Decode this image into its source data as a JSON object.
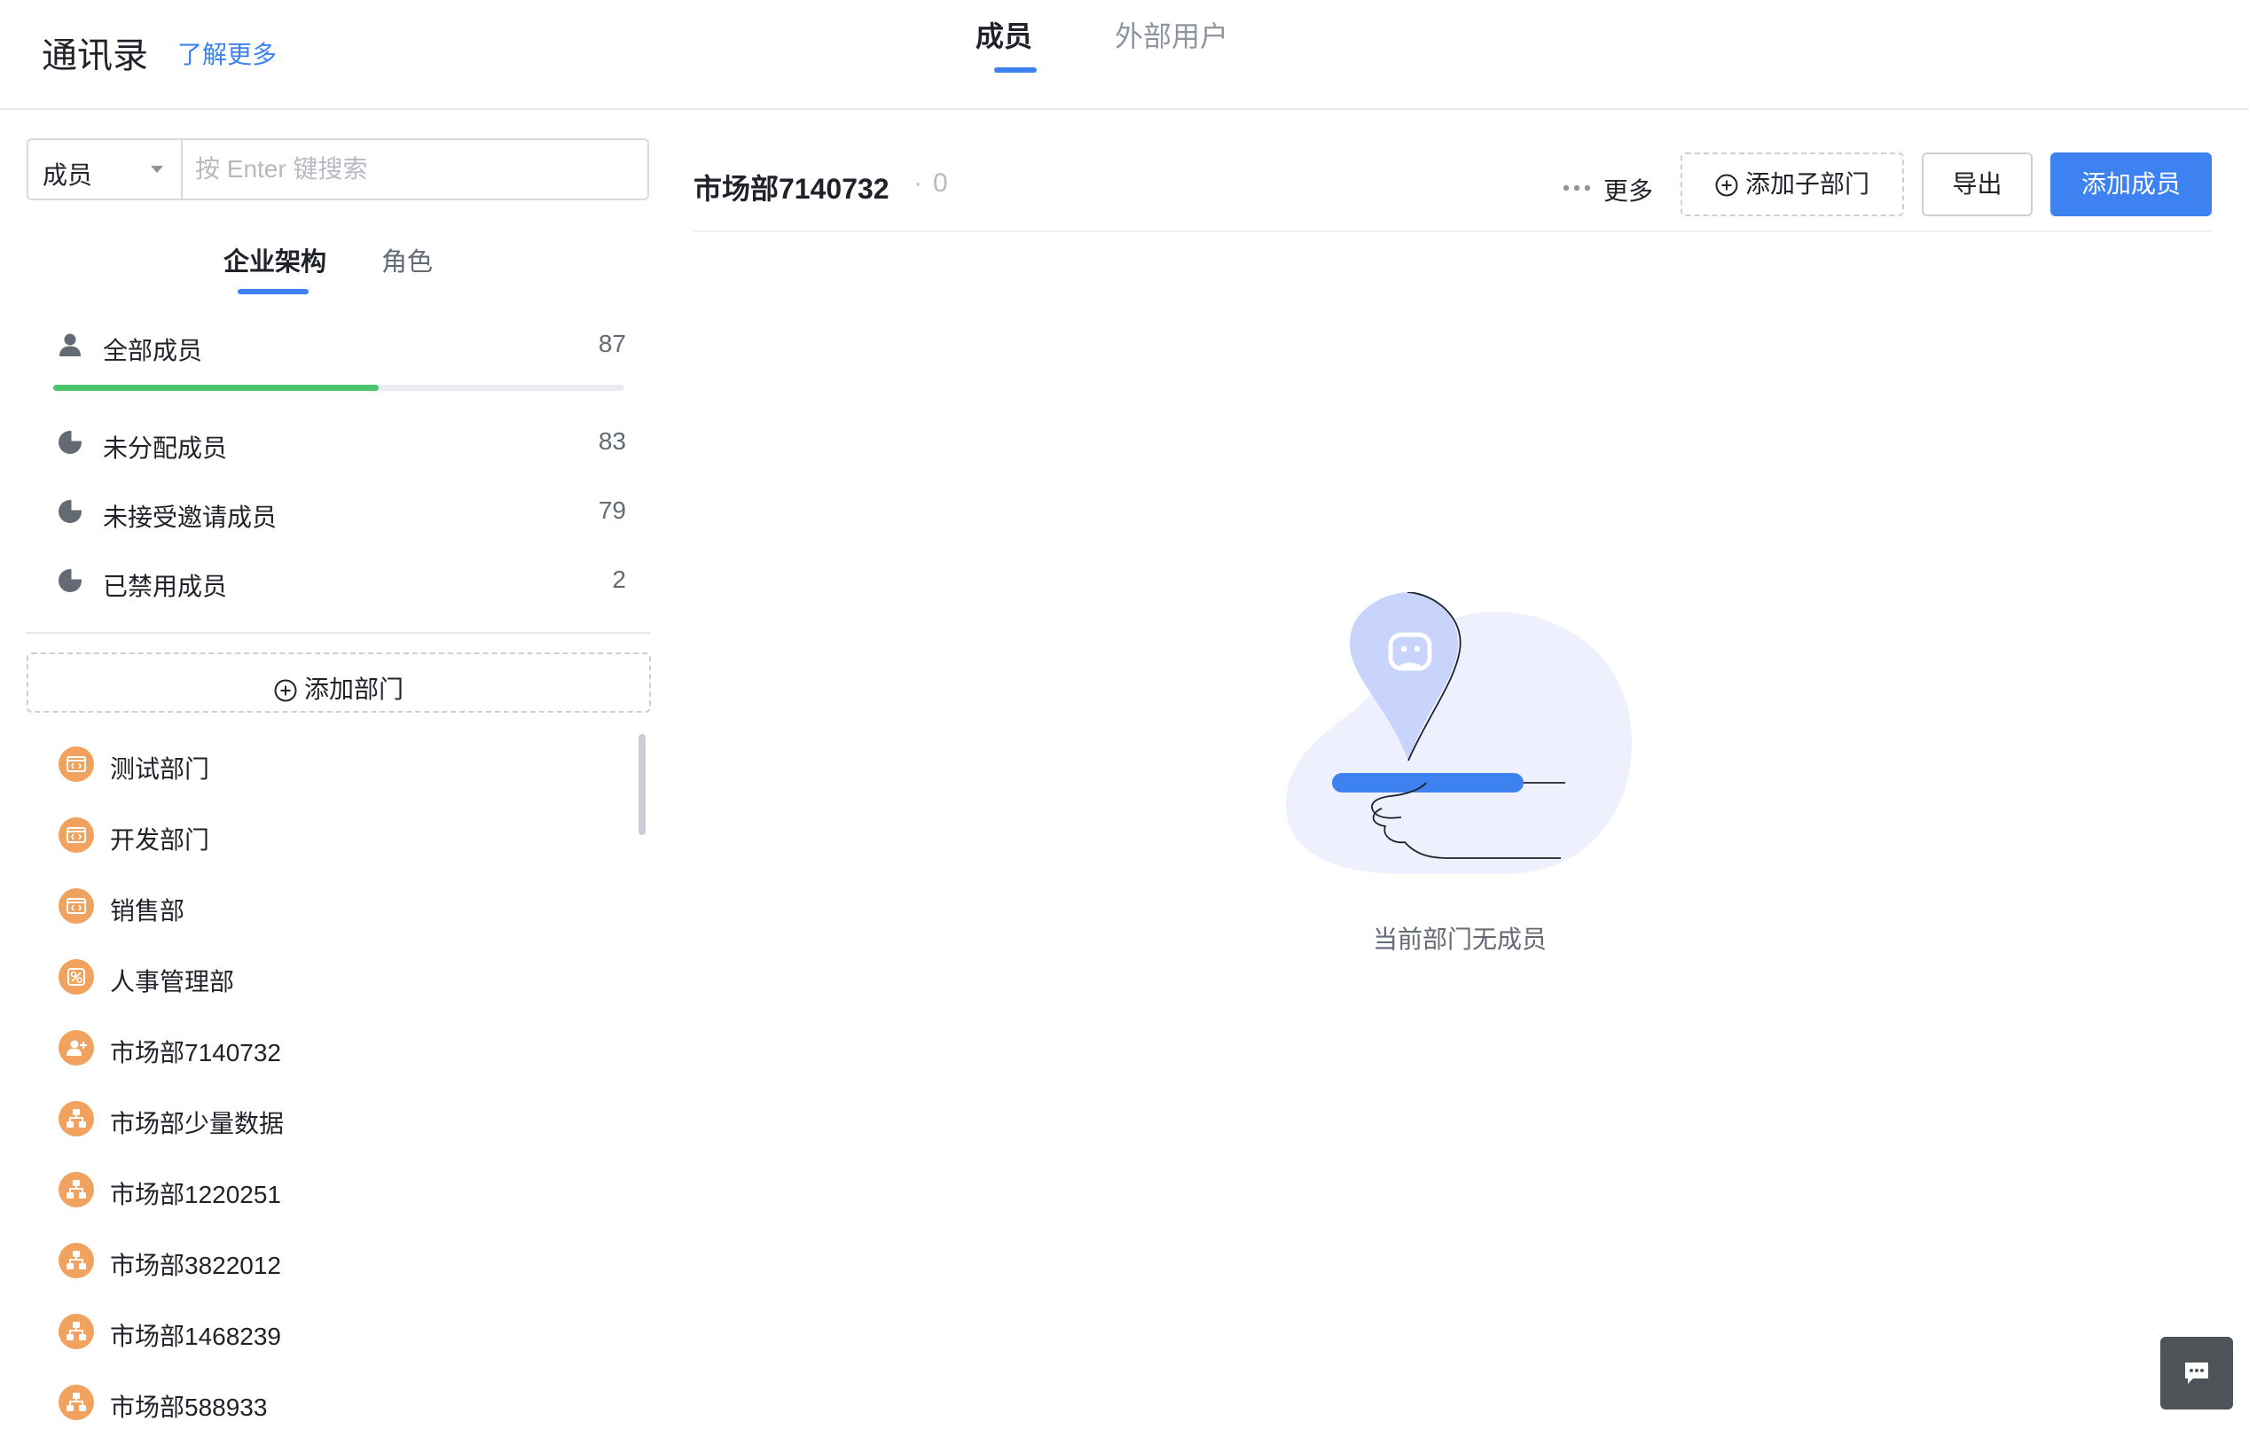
{
  "header": {
    "title": "通讯录",
    "learn_more": "了解更多",
    "tabs": [
      {
        "label": "成员",
        "active": true
      },
      {
        "label": "外部用户",
        "active": false
      }
    ]
  },
  "search": {
    "scope": "成员",
    "placeholder": "按 Enter 键搜索",
    "value": ""
  },
  "sidebar": {
    "tabs": [
      {
        "label": "企业架构",
        "active": true
      },
      {
        "label": "角色",
        "active": false
      }
    ],
    "stats": [
      {
        "label": "全部成员",
        "count": "87",
        "icon": "user-icon"
      },
      {
        "label": "未分配成员",
        "count": "83",
        "icon": "pie-chart-icon"
      },
      {
        "label": "未接受邀请成员",
        "count": "79",
        "icon": "pie-chart-icon"
      },
      {
        "label": "已禁用成员",
        "count": "2",
        "icon": "pie-chart-icon"
      }
    ],
    "all_members_progress_pct": 57,
    "add_department_label": "添加部门",
    "departments": [
      {
        "label": "测试部门",
        "icon": "code-window-icon"
      },
      {
        "label": "开发部门",
        "icon": "code-window-icon"
      },
      {
        "label": "销售部",
        "icon": "code-window-icon"
      },
      {
        "label": "人事管理部",
        "icon": "badge-icon"
      },
      {
        "label": "市场部7140732",
        "icon": "user-add-icon"
      },
      {
        "label": "市场部少量数据",
        "icon": "org-tree-icon"
      },
      {
        "label": "市场部1220251",
        "icon": "org-tree-icon"
      },
      {
        "label": "市场部3822012",
        "icon": "org-tree-icon"
      },
      {
        "label": "市场部1468239",
        "icon": "org-tree-icon"
      },
      {
        "label": "市场部588933",
        "icon": "org-tree-icon"
      }
    ]
  },
  "main": {
    "department_name": "市场部7140732",
    "separator": "·",
    "member_count": "0",
    "more_label": "更多",
    "add_subdepartment_label": "添加子部门",
    "export_label": "导出",
    "add_member_label": "添加成员",
    "empty_text": "当前部门无成员"
  },
  "colors": {
    "accent": "#3d82f0",
    "progress": "#4cc46d",
    "dept_icon": "#f0a25e",
    "illustration_blob": "#eef1fd",
    "illustration_pin": "#c8d4fb"
  }
}
